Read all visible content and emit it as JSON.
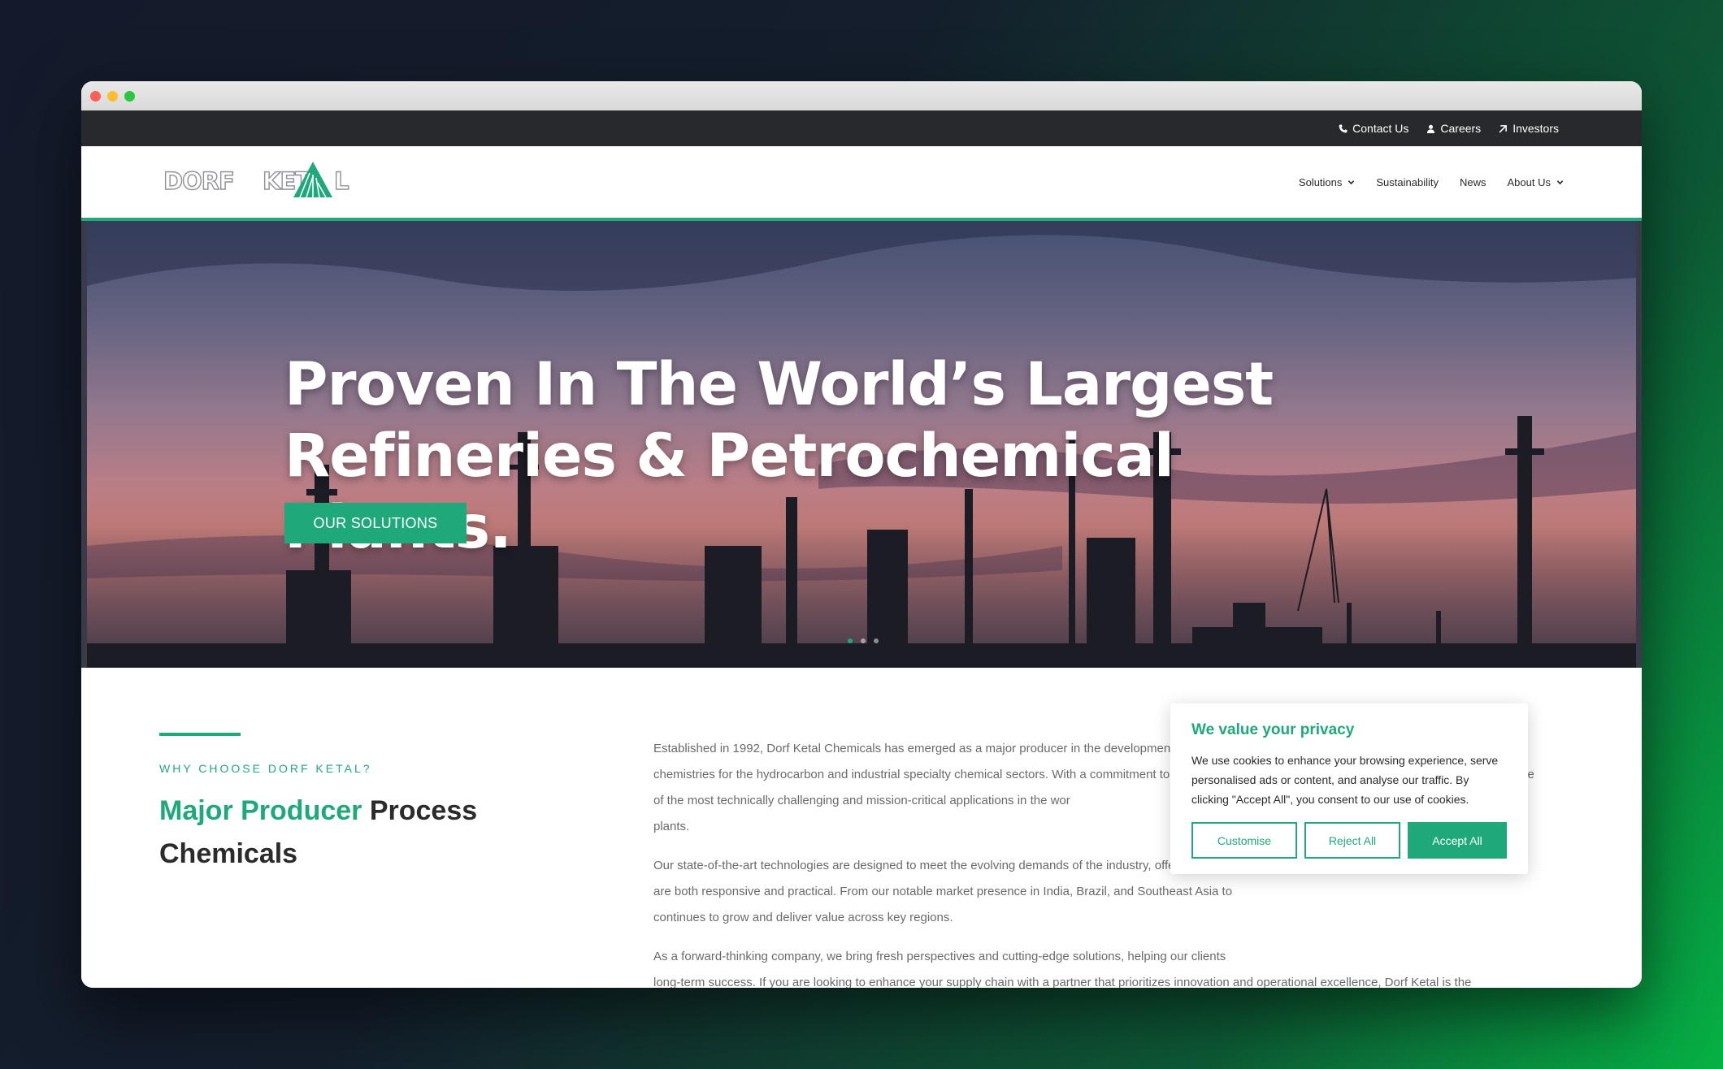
{
  "topbar": {
    "contact": "Contact Us",
    "careers": "Careers",
    "investors": "Investors"
  },
  "nav": {
    "logo_text": "DORF KETAL",
    "solutions": "Solutions",
    "sustainability": "Sustainability",
    "news": "News",
    "about": "About Us"
  },
  "hero": {
    "title": "Proven In The World’s Largest Refineries & Petrochemical Plants.",
    "button": "OUR SOLUTIONS"
  },
  "intro": {
    "kicker": "WHY CHOOSE DORF KETAL?",
    "heading_accent": "Major Producer",
    "heading_rest": " Process Chemicals",
    "paragraphs": [
      "Established in 1992, Dorf Ketal Chemicals has emerged as a major producer in the development, commercialization, and application of specialty engineered chemistries for the hydrocarbon and industrial specialty chemical sectors. With a commitment to innovation and excellence, we provide solutions that address some of the most technically challenging and mission-critical applications in the wor",
      "plants.",
      "Our state-of-the-art technologies are designed to meet the evolving demands of the industry, offering inno",
      "are both responsive and practical. From our notable market presence in India, Brazil, and Southeast Asia to",
      "continues to grow and deliver value across key regions.",
      "As a forward-thinking company, we bring fresh perspectives and cutting-edge solutions, helping our clients",
      "long-term success. If you are looking to enhance your supply chain with a partner that prioritizes innovation and operational excellence, Dorf Ketal is the"
    ]
  },
  "cookie": {
    "title": "We value your privacy",
    "text": "We use cookies to enhance your browsing experience, serve personalised ads or content, and analyse our traffic. By clicking \"Accept All\", you consent to our use of cookies.",
    "customise": "Customise",
    "reject": "Reject All",
    "accept": "Accept All"
  },
  "colors": {
    "brand_green": "#1fa97b",
    "topbar_bg": "#28292c"
  }
}
